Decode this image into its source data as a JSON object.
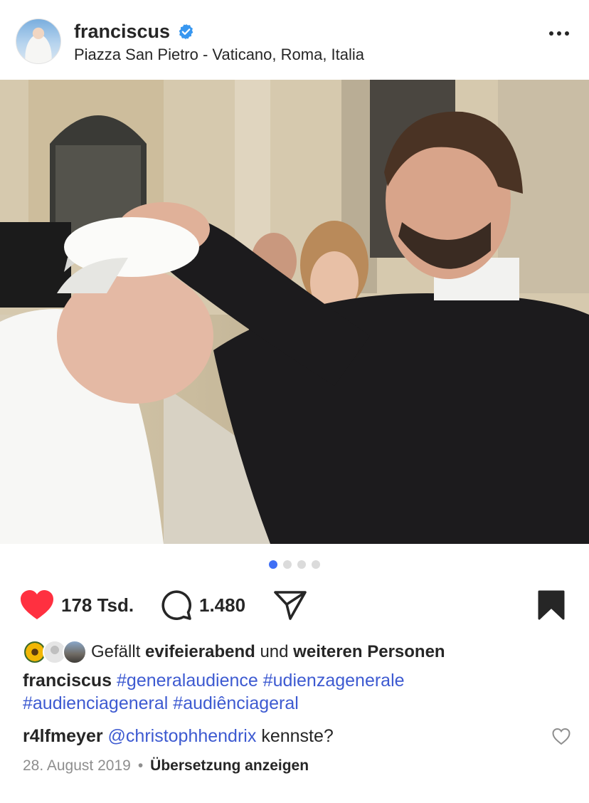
{
  "post": {
    "username": "franciscus",
    "location": "Piazza San Pietro - Vaticano, Roma, Italia",
    "photo_description_icon": "photo",
    "carousel": {
      "total": 4,
      "active_index": 0
    }
  },
  "actions": {
    "like_count": "178 Tsd.",
    "comment_count": "1.480",
    "liked": true,
    "saved": true
  },
  "likes": {
    "prefix": "Gefällt",
    "first_user": "evifeierabend",
    "connector": "und",
    "others": "weiteren Personen"
  },
  "caption": {
    "username": "franciscus",
    "hashtags": [
      "#generalaudience",
      "#udienzagenerale",
      "#audienciageneral",
      "#audiênciageral"
    ]
  },
  "comment": {
    "username": "r4lfmeyer",
    "mention": "@christophhendrix",
    "text": "kennste?"
  },
  "meta": {
    "date": "28. August 2019",
    "separator": "•",
    "translate_label": "Übersetzung anzeigen"
  },
  "colors": {
    "like_red": "#ff3040",
    "verified_blue": "#3897f0",
    "hashtag_blue": "#3d5ad1",
    "dot_active": "#3f6ff5"
  }
}
